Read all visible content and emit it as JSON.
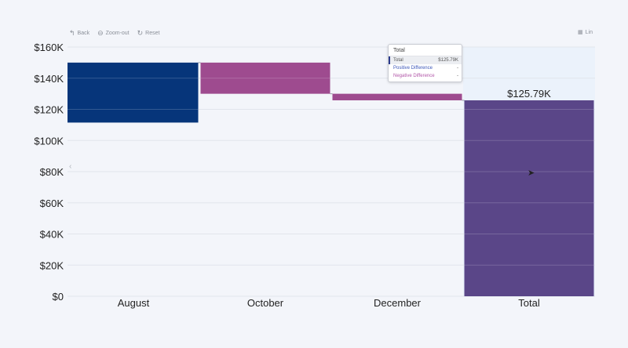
{
  "toolbar": {
    "back_label": "Back",
    "zoom_out_label": "Zoom-out",
    "reset_label": "Reset",
    "lin_label": "Lin"
  },
  "tooltip": {
    "title": "Total",
    "rows": [
      {
        "label": "Total",
        "value": "$125.79K"
      },
      {
        "label": "Positive Difference",
        "value": "-"
      },
      {
        "label": "Negative Difference",
        "value": "-"
      }
    ]
  },
  "chart_data": {
    "type": "bar",
    "subtype": "waterfall",
    "categories": [
      "August",
      "October",
      "December",
      "Total"
    ],
    "bars": [
      {
        "category": "August",
        "start": 111.5,
        "end": 150,
        "kind": "base",
        "color": "#06357a"
      },
      {
        "category": "October",
        "start": 150,
        "end": 130,
        "kind": "negative",
        "color": "#9e4b8f"
      },
      {
        "category": "December",
        "start": 130,
        "end": 125.79,
        "kind": "negative",
        "color": "#9e4b8f"
      },
      {
        "category": "Total",
        "start": 0,
        "end": 125.79,
        "kind": "total",
        "color": "#5a4688"
      }
    ],
    "total_label": "$125.79K",
    "yticks": [
      "$0",
      "$20K",
      "$40K",
      "$60K",
      "$80K",
      "$100K",
      "$120K",
      "$140K",
      "$160K"
    ],
    "ylim": [
      0,
      160
    ],
    "units": "thousands USD",
    "grid": true
  }
}
